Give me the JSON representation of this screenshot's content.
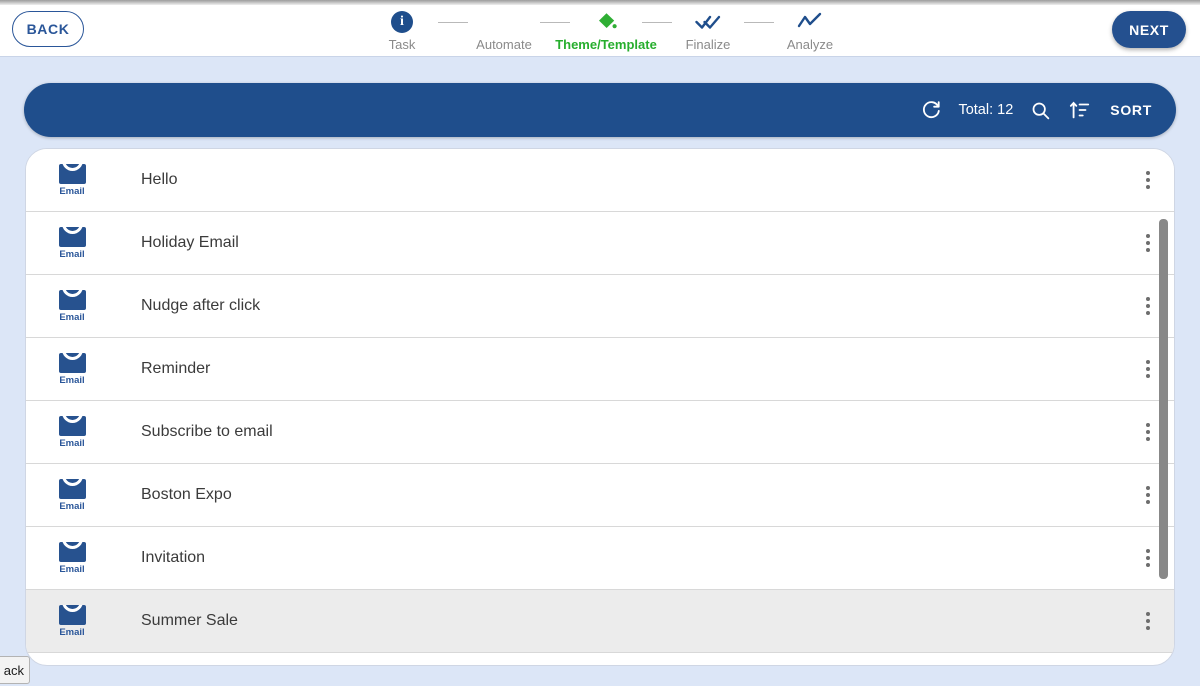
{
  "header": {
    "back_label": "BACK",
    "next_label": "NEXT",
    "steps": [
      {
        "label": "Task",
        "icon": "info-circle-icon",
        "state": "done"
      },
      {
        "label": "Automate",
        "icon": "robot-arm-icon",
        "state": "done"
      },
      {
        "label": "Theme/Template",
        "icon": "paint-bucket-icon",
        "state": "active"
      },
      {
        "label": "Finalize",
        "icon": "double-check-icon",
        "state": "upcoming"
      },
      {
        "label": "Analyze",
        "icon": "line-chart-icon",
        "state": "upcoming"
      }
    ]
  },
  "toolbar": {
    "refresh_icon": "refresh-icon",
    "total_label": "Total: 12",
    "search_icon": "search-icon",
    "sort_icon": "sort-ascending-icon",
    "sort_label": "SORT"
  },
  "list": {
    "type_label": "Email",
    "menu_icon": "more-vertical-icon",
    "rows": [
      {
        "title": "",
        "type": "Email",
        "partial": true,
        "selected": false
      },
      {
        "title": "Hello",
        "type": "Email",
        "partial": false,
        "selected": false
      },
      {
        "title": "Holiday Email",
        "type": "Email",
        "partial": false,
        "selected": false
      },
      {
        "title": "Nudge after click",
        "type": "Email",
        "partial": false,
        "selected": false
      },
      {
        "title": "Reminder",
        "type": "Email",
        "partial": false,
        "selected": false
      },
      {
        "title": "Subscribe to email",
        "type": "Email",
        "partial": false,
        "selected": false
      },
      {
        "title": "Boston Expo",
        "type": "Email",
        "partial": false,
        "selected": false
      },
      {
        "title": "Invitation",
        "type": "Email",
        "partial": false,
        "selected": false
      },
      {
        "title": "Summer Sale",
        "type": "Email",
        "partial": false,
        "selected": true
      }
    ]
  },
  "overlay": {
    "clipped_back_label": "ack"
  },
  "colors": {
    "page_background": "#dce6f7",
    "brand_blue": "#1f4e8c",
    "active_green": "#27ae2e",
    "selected_row": "#ececec",
    "muted_text": "#8a8a8a"
  }
}
